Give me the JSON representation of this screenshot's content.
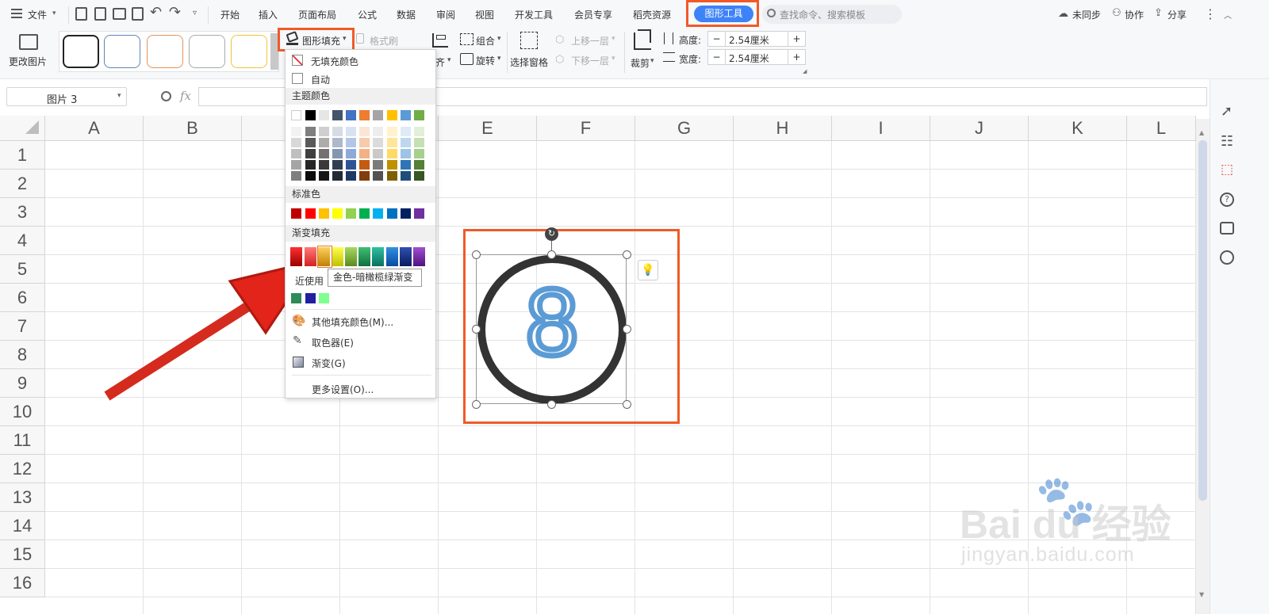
{
  "menubar": {
    "file": "文件",
    "tabs": [
      "开始",
      "插入",
      "页面布局",
      "公式",
      "数据",
      "审阅",
      "视图",
      "开发工具",
      "会员专享",
      "稻壳资源"
    ],
    "active_tab": "图形工具",
    "search_placeholder": "查找命令、搜索模板",
    "sync": "未同步",
    "collab": "协作",
    "share": "分享"
  },
  "ribbon": {
    "change_picture": "更改图片",
    "shape_fill": "图形填充",
    "format_painter": "格式刷",
    "align": "齐",
    "group": "组合",
    "rotate": "旋转",
    "selection_pane": "选择窗格",
    "bring_forward": "上移一层",
    "send_backward": "下移一层",
    "crop": "裁剪",
    "height_label": "高度:",
    "height_value": "2.54厘米",
    "width_label": "宽度:",
    "width_value": "2.54厘米",
    "minus": "−",
    "plus": "+"
  },
  "formula_bar": {
    "name_box": "图片 3",
    "fx": "fx"
  },
  "sheet": {
    "columns": [
      "A",
      "B",
      "C",
      "D",
      "E",
      "F",
      "G",
      "H",
      "I",
      "J",
      "K",
      "L"
    ],
    "rows": [
      "1",
      "2",
      "3",
      "4",
      "5",
      "6",
      "7",
      "8",
      "9",
      "10",
      "11",
      "12",
      "13",
      "14",
      "15",
      "16"
    ]
  },
  "shape": {
    "digit": "8"
  },
  "dropdown": {
    "no_fill": "无填充颜色",
    "auto": "自动",
    "theme_colors": "主题颜色",
    "standard_colors": "标准色",
    "gradient_fill": "渐变填充",
    "recent": "近使用",
    "more_colors": "其他填充颜色(M)...",
    "eyedropper": "取色器(E)",
    "gradient": "渐变(G)",
    "more_settings": "更多设置(O)...",
    "theme_row": [
      "#ffffff",
      "#000000",
      "#e7e6e6",
      "#44546a",
      "#4472c4",
      "#ed7d31",
      "#a5a5a5",
      "#ffc000",
      "#5b9bd5",
      "#70ad47"
    ],
    "theme_shades": [
      [
        "#f2f2f2",
        "#7f7f7f",
        "#d0cece",
        "#d6dce4",
        "#d9e2f3",
        "#fbe5d5",
        "#ededed",
        "#fff2cc",
        "#deebf6",
        "#e2efd9"
      ],
      [
        "#d8d8d8",
        "#595959",
        "#aeabab",
        "#adb9ca",
        "#b4c6e7",
        "#f7cbac",
        "#dbdbdb",
        "#fee599",
        "#bdd7ee",
        "#c5e0b3"
      ],
      [
        "#bfbfbf",
        "#3f3f3f",
        "#757070",
        "#8496b0",
        "#8eaadb",
        "#f4b183",
        "#c9c9c9",
        "#ffd965",
        "#9dc3e6",
        "#a8d08d"
      ],
      [
        "#a5a5a5",
        "#262626",
        "#3a3838",
        "#323f4f",
        "#2f5496",
        "#c55a11",
        "#7b7b7b",
        "#bf9000",
        "#2e75b5",
        "#538135"
      ],
      [
        "#7f7f7f",
        "#0c0c0c",
        "#171616",
        "#222a35",
        "#1f3864",
        "#833c0b",
        "#525252",
        "#7f6000",
        "#1e4e79",
        "#375623"
      ]
    ],
    "standard": [
      "#c00000",
      "#ff0000",
      "#ffc000",
      "#ffff00",
      "#92d050",
      "#00b050",
      "#00b0f0",
      "#0070c0",
      "#002060",
      "#7030a0"
    ],
    "gradient_colors": [
      [
        "#ff3030",
        "#9a0000"
      ],
      [
        "#ff7a7a",
        "#d42020"
      ],
      [
        "#ffd060",
        "#c08000"
      ],
      [
        "#ffff50",
        "#c0c000"
      ],
      [
        "#a8d860",
        "#5a8a20"
      ],
      [
        "#40c070",
        "#107040"
      ],
      [
        "#30c0a0",
        "#0a7060"
      ],
      [
        "#3090e0",
        "#0a4aa0"
      ],
      [
        "#3050b0",
        "#0a1a60"
      ],
      [
        "#a050d0",
        "#501080"
      ]
    ],
    "recent_colors": [
      "#2e8b57",
      "#2020a0",
      "#7fff8f"
    ]
  },
  "tooltip": "金色-暗橄榄绿渐变",
  "watermark": {
    "brand": "Bai du 经验",
    "url": "jingyan.baidu.com"
  }
}
